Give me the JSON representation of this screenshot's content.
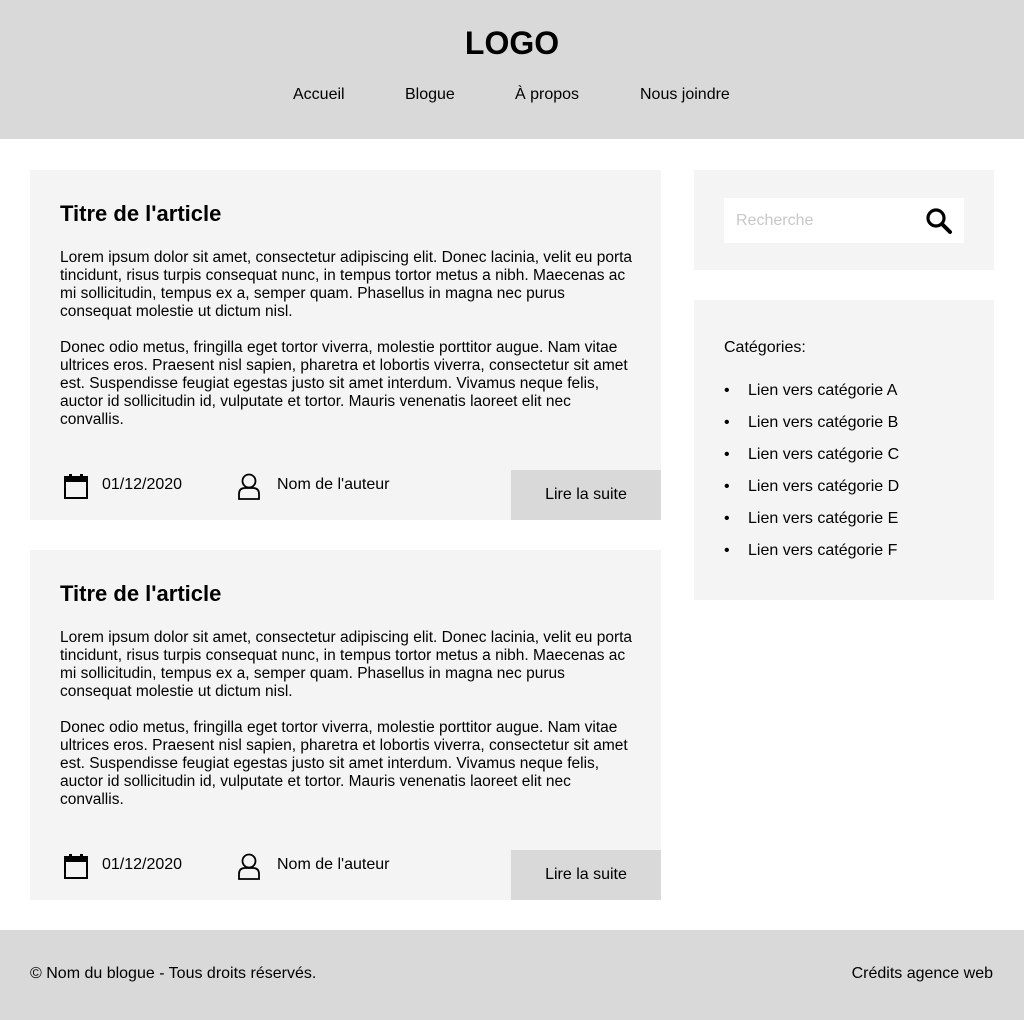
{
  "header": {
    "logo": "LOGO",
    "nav": [
      "Accueil",
      "Blogue",
      "À propos",
      "Nous joindre"
    ]
  },
  "articles": [
    {
      "title": "Titre de l'article",
      "paragraphs": [
        "Lorem ipsum dolor sit amet, consectetur adipiscing elit. Donec lacinia, velit eu porta tincidunt, risus turpis consequat nunc, in tempus tortor metus a nibh. Maecenas ac mi sollicitudin, tempus ex a, semper quam. Phasellus in magna nec purus consequat molestie ut dictum nisl.",
        "Donec odio metus, fringilla eget tortor viverra, molestie porttitor augue. Nam vitae ultrices eros. Praesent nisl sapien, pharetra et lobortis viverra, consectetur sit amet est. Suspendisse feugiat egestas justo sit amet interdum. Vivamus neque felis, auctor id sollicitudin id, vulputate et tortor. Mauris venenatis laoreet elit nec convallis."
      ],
      "date": "01/12/2020",
      "author": "Nom de l'auteur",
      "read_more": "Lire la suite"
    },
    {
      "title": "Titre de l'article",
      "paragraphs": [
        "Lorem ipsum dolor sit amet, consectetur adipiscing elit. Donec lacinia, velit eu porta tincidunt, risus turpis consequat nunc, in tempus tortor metus a nibh. Maecenas ac mi sollicitudin, tempus ex a, semper quam. Phasellus in magna nec purus consequat molestie ut dictum nisl.",
        "Donec odio metus, fringilla eget tortor viverra, molestie porttitor augue. Nam vitae ultrices eros. Praesent nisl sapien, pharetra et lobortis viverra, consectetur sit amet est. Suspendisse feugiat egestas justo sit amet interdum. Vivamus neque felis, auctor id sollicitudin id, vulputate et tortor. Mauris venenatis laoreet elit nec convallis."
      ],
      "date": "01/12/2020",
      "author": "Nom de l'auteur",
      "read_more": "Lire la suite"
    }
  ],
  "sidebar": {
    "search": {
      "placeholder": "Recherche",
      "value": "",
      "icon": "search-icon"
    },
    "categories": {
      "title": "Catégories:",
      "bullet": "•",
      "items": [
        "Lien vers catégorie A",
        "Lien vers catégorie B",
        "Lien vers catégorie C",
        "Lien vers catégorie D",
        "Lien vers catégorie E",
        "Lien vers catégorie F"
      ]
    }
  },
  "footer": {
    "copyright": "© Nom du blogue - Tous droits réservés.",
    "credits": "Crédits agence web"
  },
  "colors": {
    "header_bg": "#d9d9d9",
    "card_bg": "#f4f4f4",
    "button_bg": "#d9d9d9",
    "page_bg": "#ffffff",
    "text": "#000000",
    "placeholder": "#c8c8c8"
  },
  "icons": {
    "date": "calendar-icon",
    "author": "user-icon",
    "search": "search-icon"
  }
}
